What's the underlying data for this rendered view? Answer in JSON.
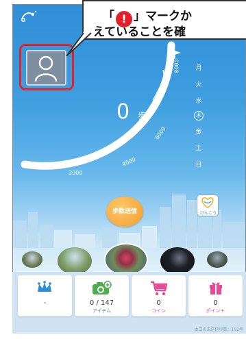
{
  "callout": {
    "line1_open": "「",
    "exclamation": "!",
    "line1_rest": "」マークか",
    "line2": "えていることを確"
  },
  "pedometer": {
    "steps_value": "0",
    "steps_unit": "歩",
    "ticks": [
      "2000",
      "4000",
      "6000",
      "8000"
    ],
    "weekdays": [
      "月",
      "火",
      "水",
      "木",
      "金",
      "土",
      "日"
    ],
    "today_index": 3
  },
  "actions": {
    "send_steps_label": "歩数送信",
    "kenkou_label": "けんこう"
  },
  "footer": {
    "rank_value": "-",
    "items_value": "0 / 147",
    "items_label": "アイテム",
    "coins_value": "0",
    "coins_label": "コイン",
    "points_value": "0",
    "points_label": "ポイント",
    "footnote": "本日の未送信歩数：192歩"
  },
  "colors": {
    "accent_red": "#e2232a",
    "brand_blue": "#2f8ed6",
    "send_orange": "#f19d2b",
    "pink": "#e84b95",
    "green": "#4cae4f"
  },
  "icons": [
    "share-icon",
    "avatar-icon",
    "flag-icon",
    "heart-icon",
    "crown-icon",
    "camera-icon",
    "cart-icon",
    "gift-icon"
  ]
}
